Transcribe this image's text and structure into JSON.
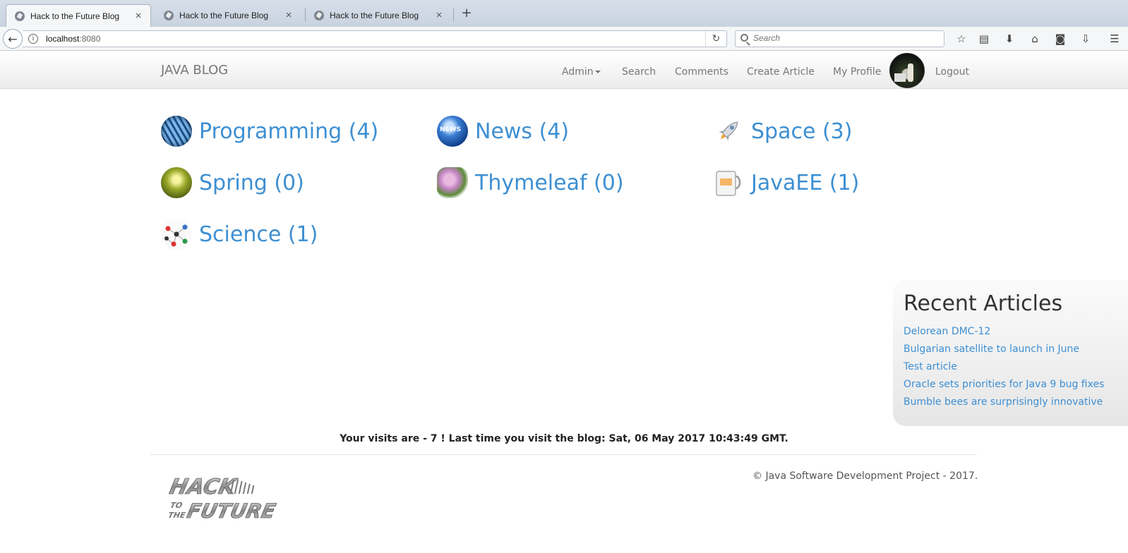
{
  "browser": {
    "tabs": [
      {
        "title": "Hack to the Future Blog"
      },
      {
        "title": "Hack to the Future Blog"
      },
      {
        "title": "Hack to the Future Blog"
      }
    ],
    "url_host": "localhost",
    "url_port": ":8080",
    "search_placeholder": "Search"
  },
  "site": {
    "brand": "JAVA BLOG",
    "nav": {
      "admin": "Admin",
      "search": "Search",
      "comments": "Comments",
      "create_article": "Create Article",
      "my_profile": "My Profile",
      "logout": "Logout"
    }
  },
  "categories": [
    {
      "label": "Programming (4)",
      "icon": "programming-icon"
    },
    {
      "label": "News (4)",
      "icon": "news-globe-icon"
    },
    {
      "label": "Space (3)",
      "icon": "rocket-icon"
    },
    {
      "label": "Spring (0)",
      "icon": "spring-icon"
    },
    {
      "label": "Thymeleaf (0)",
      "icon": "thymeleaf-icon"
    },
    {
      "label": "JavaEE (1)",
      "icon": "java-mug-icon"
    },
    {
      "label": "Science (1)",
      "icon": "molecule-icon"
    }
  ],
  "recent": {
    "title": "Recent Articles",
    "articles": [
      "Delorean DMC-12",
      "Bulgarian satellite to launch in June",
      "Test article",
      "Oracle sets priorities for Java 9 bug fixes",
      "Bumble bees are surprisingly innovative"
    ]
  },
  "footer": {
    "visits": "Your visits are - 7 ! Last time you visit the blog: Sat, 06 May 2017 10:43:49 GMT.",
    "copyright": "© Java Software Development Project - 2017.",
    "logo_text": "HACK TO THE FUTURE"
  }
}
